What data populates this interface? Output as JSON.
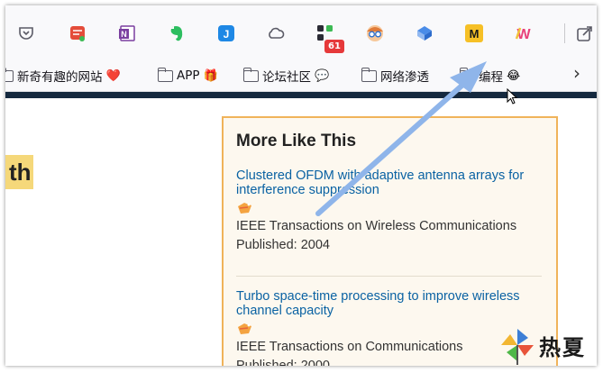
{
  "toolbar": {
    "extensions": [
      {
        "name": "pocket-icon",
        "color": "#5b5b66"
      },
      {
        "name": "todo-extension-icon",
        "color": "#e44c3a"
      },
      {
        "name": "onenote-icon",
        "color": "#7b3fa0",
        "glyph": "N"
      },
      {
        "name": "evernote-icon",
        "color": "#2dbe60"
      },
      {
        "name": "jianguoyun-icon",
        "color": "#1e88e5",
        "glyph": "J"
      },
      {
        "name": "cloud-icon",
        "color": "#5b5b66"
      },
      {
        "name": "apps-extension-icon",
        "color": "#2b2b35"
      },
      {
        "name": "avatar-extension-icon",
        "color": "#f0a24a"
      },
      {
        "name": "translate-extension-icon",
        "color": "#4a8ce8"
      },
      {
        "name": "m-extension-icon",
        "color": "#f6c026",
        "glyph": "M"
      },
      {
        "name": "w-extension-icon",
        "color": "#f3c23a",
        "glyph": "W"
      },
      {
        "name": "share-icon",
        "color": "#5b5b66"
      }
    ],
    "badge_count": "61"
  },
  "bookmarks": [
    {
      "label": "新奇有趣的网站",
      "emoji": "❤️"
    },
    {
      "label": "APP",
      "emoji": "🎁"
    },
    {
      "label": "论坛社区",
      "emoji": "💬"
    },
    {
      "label": "网络渗透",
      "emoji": ""
    },
    {
      "label": "编程",
      "emoji": "😂"
    }
  ],
  "page": {
    "title_fragment": "th",
    "title_highlight_color": "#f5d87a",
    "topbar_color": "#15293f"
  },
  "sidebar": {
    "title": "More Like This",
    "border_color": "#f0b35a",
    "link_color": "#0a62a3",
    "items": [
      {
        "title": "Clustered OFDM with adaptive antenna arrays for interference suppression",
        "journal": "IEEE Transactions on Wireless Communications",
        "published": "Published: 2004"
      },
      {
        "title": "Turbo space-time processing to improve wireless channel capacity",
        "journal": "IEEE Transactions on Communications",
        "published": "Published: 2000"
      }
    ]
  },
  "annotation": {
    "arrow_color": "#8fb5ea"
  },
  "watermark": {
    "text": "热夏"
  }
}
